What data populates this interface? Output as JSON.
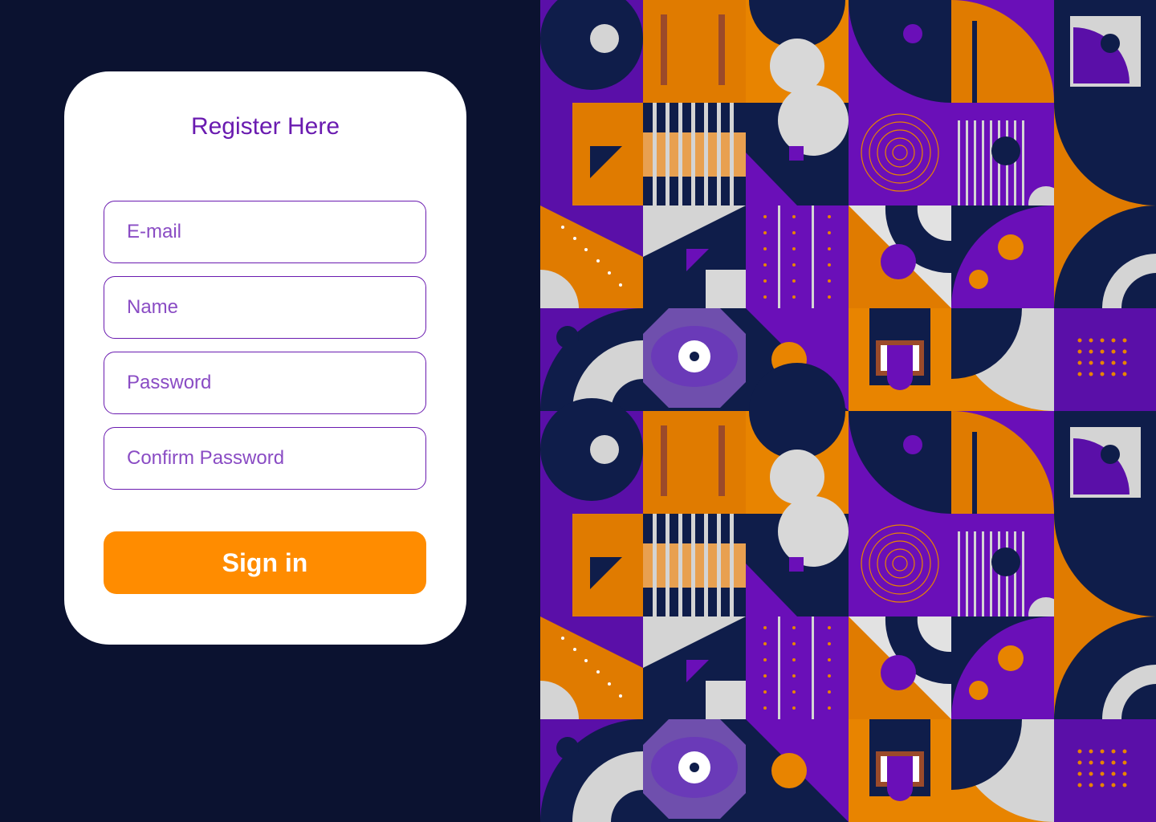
{
  "form": {
    "title": "Register Here",
    "fields": [
      {
        "placeholder": "E-mail",
        "value": ""
      },
      {
        "placeholder": "Name",
        "value": ""
      },
      {
        "placeholder": "Password",
        "value": ""
      },
      {
        "placeholder": "Confirm Password",
        "value": ""
      }
    ],
    "submit_label": "Sign in"
  },
  "colors": {
    "background": "#0b1230",
    "accent_purple": "#6a1bb0",
    "accent_orange": "#ff8c00",
    "card": "#ffffff"
  }
}
